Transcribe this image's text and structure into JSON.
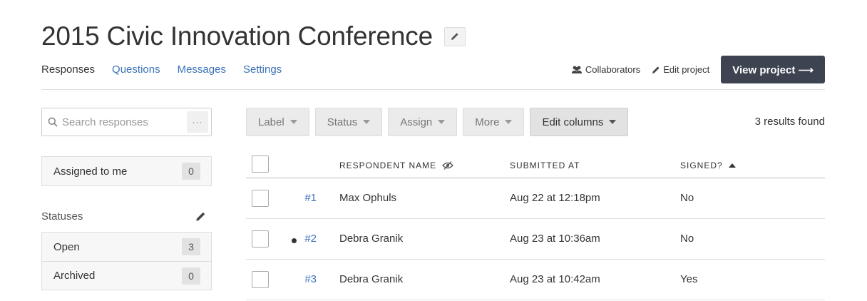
{
  "header": {
    "title": "2015 Civic Innovation Conference"
  },
  "nav": {
    "tabs": [
      {
        "label": "Responses",
        "active": true
      },
      {
        "label": "Questions",
        "active": false
      },
      {
        "label": "Messages",
        "active": false
      },
      {
        "label": "Settings",
        "active": false
      }
    ],
    "collaborators_label": "Collaborators",
    "edit_project_label": "Edit project",
    "view_project_label": "View project ⟶"
  },
  "sidebar": {
    "search_placeholder": "Search responses",
    "search_more": "···",
    "filters": [
      {
        "label": "Assigned to me",
        "count": "0"
      }
    ],
    "statuses_heading": "Statuses",
    "statuses": [
      {
        "label": "Open",
        "count": "3"
      },
      {
        "label": "Archived",
        "count": "0"
      }
    ]
  },
  "toolbar": {
    "buttons": [
      "Label",
      "Status",
      "Assign",
      "More",
      "Edit columns"
    ],
    "results_text": "3 results found"
  },
  "table": {
    "columns": [
      "RESPONDENT NAME",
      "SUBMITTED AT",
      "SIGNED?"
    ],
    "rows": [
      {
        "num": "#1",
        "name": "Max Ophuls",
        "submitted": "Aug 22 at 12:18pm",
        "signed": "No",
        "unread": false
      },
      {
        "num": "#2",
        "name": "Debra Granik",
        "submitted": "Aug 23 at 10:36am",
        "signed": "No",
        "unread": true
      },
      {
        "num": "#3",
        "name": "Debra Granik",
        "submitted": "Aug 23 at 10:42am",
        "signed": "Yes",
        "unread": false
      }
    ]
  },
  "colors": {
    "link": "#3b73b9",
    "primary_button": "#3d4351",
    "text": "#333333"
  }
}
